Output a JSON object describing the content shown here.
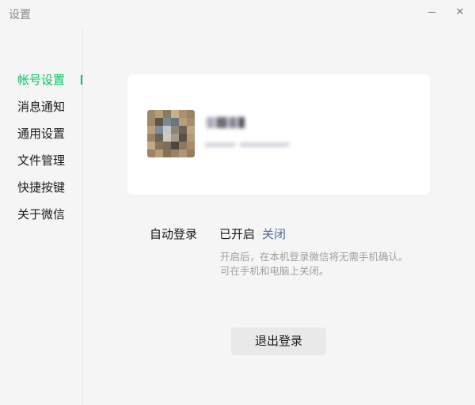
{
  "window": {
    "title": "设置",
    "minimize_label": "",
    "close_label": "✕"
  },
  "sidebar": {
    "items": [
      {
        "label": "帐号设置"
      },
      {
        "label": "消息通知"
      },
      {
        "label": "通用设置"
      },
      {
        "label": "文件管理"
      },
      {
        "label": "快捷按键"
      },
      {
        "label": "关于微信"
      }
    ],
    "accent_color": "#07c160"
  },
  "account": {
    "avatar_icon": "user-avatar-pixelated"
  },
  "auto_login": {
    "label": "自动登录",
    "status": "已开启",
    "action": "关闭",
    "description_line1": "开启后，在本机登录微信将无需手机确认。",
    "description_line2": "可在手机和电脑上关闭。"
  },
  "logout": {
    "label": "退出登录"
  }
}
